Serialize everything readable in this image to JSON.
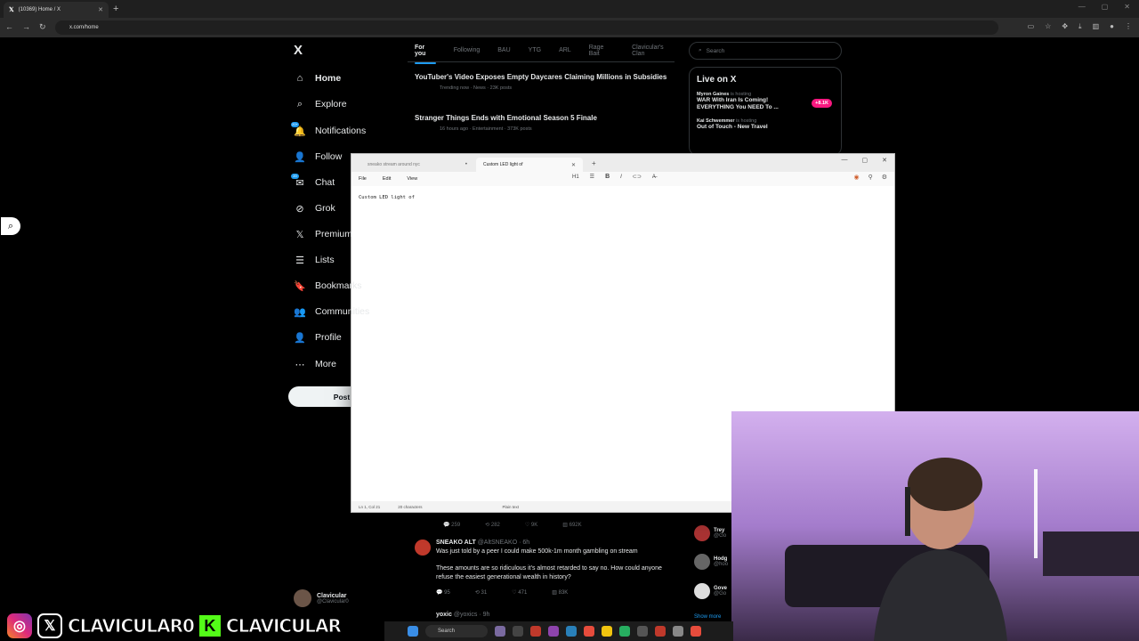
{
  "browser": {
    "tab_title": "(10369) Home / X",
    "url": "x.com/home"
  },
  "x_nav": {
    "logo": "X",
    "items": [
      {
        "label": "Home",
        "icon": "home-icon"
      },
      {
        "label": "Explore",
        "icon": "search-icon"
      },
      {
        "label": "Notifications",
        "icon": "bell-icon",
        "badge": "20+"
      },
      {
        "label": "Follow",
        "icon": "follow-icon"
      },
      {
        "label": "Chat",
        "icon": "mail-icon",
        "badge": "20"
      },
      {
        "label": "Grok",
        "icon": "grok-icon"
      },
      {
        "label": "Premium",
        "icon": "x-icon"
      },
      {
        "label": "Lists",
        "icon": "list-icon"
      },
      {
        "label": "Bookmarks",
        "icon": "bookmark-icon"
      },
      {
        "label": "Communities",
        "icon": "communities-icon"
      },
      {
        "label": "Profile",
        "icon": "person-icon"
      },
      {
        "label": "More",
        "icon": "more-icon"
      }
    ],
    "post_label": "Post",
    "account": {
      "name": "Clavicular",
      "handle": "@Clavicular0"
    }
  },
  "feed": {
    "tabs": [
      "For you",
      "Following",
      "BAU",
      "YTG",
      "ARL",
      "Rage Bait",
      "Clavicular's Clan"
    ],
    "trends": [
      {
        "title": "YouTuber's Video Exposes Empty Daycares Claiming Millions in Subsidies",
        "meta": "Trending now · News · 23K posts"
      },
      {
        "title": "Stranger Things Ends with Emotional Season 5 Finale",
        "meta": "16 hours ago · Entertainment · 373K posts"
      }
    ],
    "actions_row1": {
      "replies": "259",
      "reposts": "282",
      "likes": "9K",
      "views": "692K"
    },
    "tweet": {
      "name": "SNEAKO ALT",
      "handle": "@AltSNEAKO · 6h",
      "text1": "Was just told by a peer I could make 500k-1m month gambling on stream",
      "text2": "These amounts are so ridiculous it's almost retarded to say no. How could anyone refuse the easiest generational wealth in history?",
      "replies": "95",
      "reposts": "31",
      "likes": "471",
      "views": "83K"
    },
    "tweet2": {
      "name": "yoxic",
      "handle": "@yoxics · 9h"
    }
  },
  "right": {
    "search_placeholder": "Search",
    "live_title": "Live on X",
    "live": [
      {
        "host": "Myron Gaines",
        "status": "is hosting",
        "title": "WAR With Iran Is Coming! EVERYTHING You NEED To ...",
        "count": "+8.1K"
      },
      {
        "host": "Kai Schwemmer",
        "status": "is hosting",
        "title": "Out of Touch - New Travel"
      }
    ],
    "who_to_follow": [
      {
        "name": "Trey",
        "handle": "@Go"
      },
      {
        "name": "Hodg",
        "handle": "@hoo"
      },
      {
        "name": "Gove",
        "handle": "@Go"
      }
    ],
    "show_more": "Show more"
  },
  "notepad": {
    "tab1": "sneako stream around nyc",
    "tab2": "Custom LED light of",
    "menu": [
      "File",
      "Edit",
      "View"
    ],
    "heading_btn": "H1",
    "content": "Custom LED light of",
    "status_pos": "Ln 1, Col 21",
    "status_chars": "20 characters",
    "status_format": "Plain text"
  },
  "overlay": {
    "left_name": "CLAVICULAR0",
    "right_name": "CLAVICULAR"
  },
  "taskbar": {
    "search": "Search"
  },
  "colors": {
    "accent": "#1d9bf0",
    "live_badge": "#f91880",
    "kick": "#53fc18"
  }
}
